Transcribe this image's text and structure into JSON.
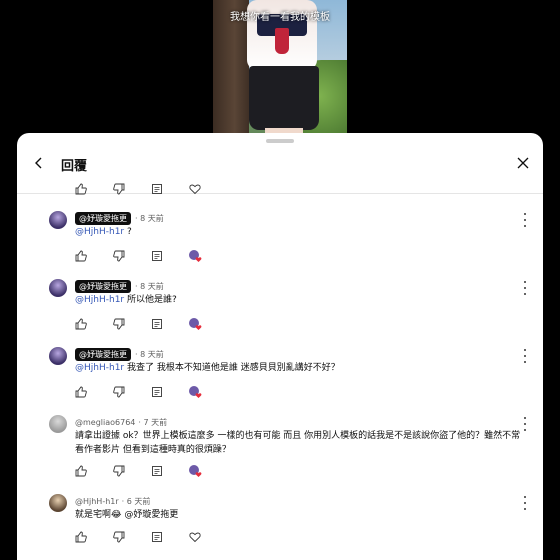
{
  "video": {
    "caption": "我想你看一看我的模板"
  },
  "header": {
    "title": "回覆"
  },
  "comments": [
    {
      "author_badge": "@妤璇愛拖更",
      "time": "· 8 天前",
      "mention": "@HjhH-h1r",
      "text": "?"
    },
    {
      "author_badge": "@妤璇愛拖更",
      "time": "· 8 天前",
      "mention": "@HjhH-h1r",
      "text": "所以他是誰?"
    },
    {
      "author_badge": "@妤璇愛拖更",
      "time": "· 8 天前",
      "mention": "@HjhH-h1r",
      "text": "我查了 我根本不知道他是誰 迷感貝貝別亂講好不好？"
    },
    {
      "author": "@megliao6764",
      "time": "· 7 天前",
      "text": "請拿出證據 ok？世界上模板這麼多 一樣的也有可能 而且 你用別人模板的話我是不是該說你盜了他的？雖然不常看作者影片 但看到這種時真的很煩躁？"
    },
    {
      "author": "@HjhH-h1r",
      "time": "· 6 天前",
      "text": "就是宅啊😂 @妤璇愛拖更"
    }
  ]
}
